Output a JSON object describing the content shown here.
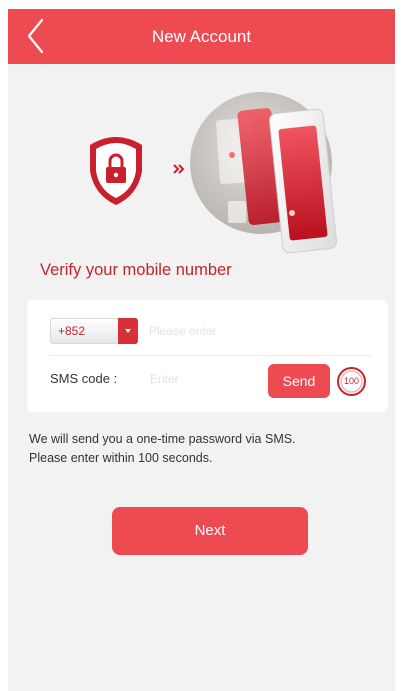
{
  "header": {
    "title": "New Account",
    "back_icon": "chevron-left-icon"
  },
  "illustration": {
    "icons": [
      "shield-lock-icon",
      "double-chevron-right-icon",
      "phone-screens-icon"
    ]
  },
  "verify": {
    "title": "Verify your mobile number"
  },
  "form": {
    "country_code": "+852",
    "phone_placeholder": "Please enter",
    "sms_label": "SMS code :",
    "sms_placeholder": "Enter",
    "send_label": "Send",
    "countdown": "100"
  },
  "info": {
    "line1": "We will send you a one-time password via SMS.",
    "line2": "Please enter within 100 seconds."
  },
  "footer": {
    "next_label": "Next"
  },
  "colors": {
    "accent": "#ee4a52",
    "dark_accent": "#c0262e",
    "background": "#f2f2f2"
  }
}
